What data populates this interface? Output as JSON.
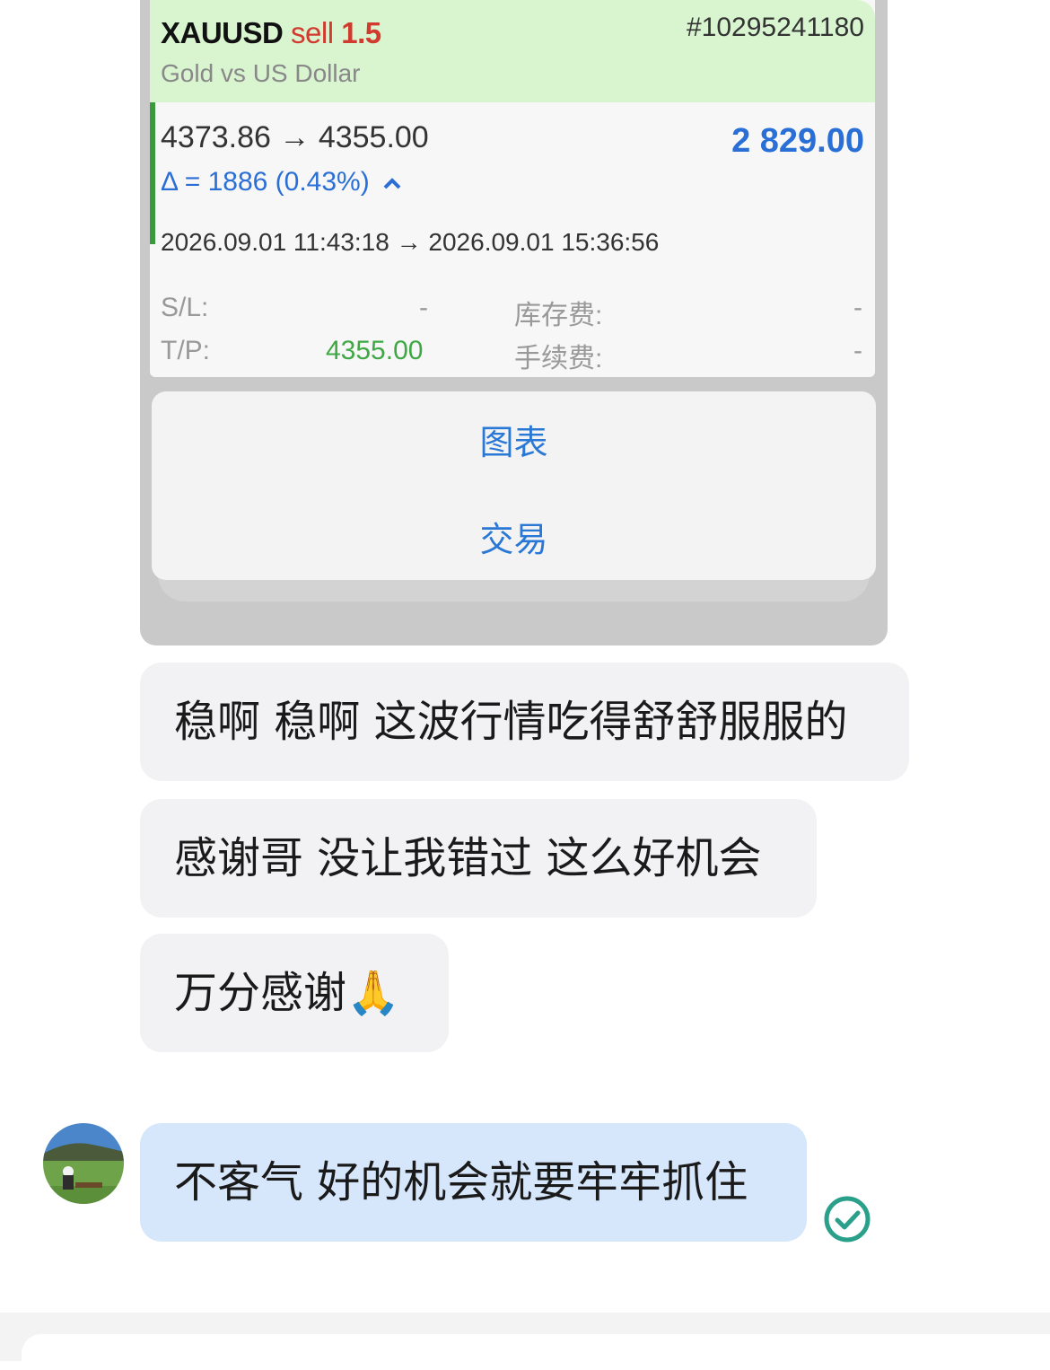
{
  "trade_card": {
    "symbol": "XAUUSD",
    "side": "sell",
    "lots": "1.5",
    "ticket": "#10295241180",
    "description": "Gold vs US Dollar",
    "price_open": "4373.86",
    "arrow": "→",
    "price_close": "4355.00",
    "profit": "2 829.00",
    "delta": "Δ = 1886 (0.43%)",
    "time_open": "2026.09.01 11:43:18",
    "time_close": "2026.09.01 15:36:56",
    "sl_label": "S/L:",
    "sl_value": "-",
    "tp_label": "T/P:",
    "tp_value": "4355.00",
    "swap_label": "库存费:",
    "swap_value": "-",
    "commission_label": "手续费:",
    "commission_value": "-"
  },
  "popup_menu": {
    "items": [
      "图表",
      "交易"
    ]
  },
  "messages": [
    {
      "text": "稳啊 稳啊 这波行情吃得舒舒服服的",
      "sender": "other"
    },
    {
      "text": "感谢哥 没让我错过 这么好机会",
      "sender": "other"
    },
    {
      "text": "万分感谢🙏",
      "sender": "other"
    },
    {
      "text": "不客气 好的机会就要牢牢抓住",
      "sender": "me",
      "status": "read"
    }
  ],
  "icons": {
    "read_receipt": "check-circle-icon",
    "avatar": "avatar"
  },
  "colors": {
    "sell": "#d13b2f",
    "profit": "#2a6fd6",
    "tp": "#3fa845",
    "menu_text": "#2a78d6",
    "my_bubble": "#d6e6fb",
    "other_bubble": "#f2f2f4",
    "check": "#2aa08a"
  }
}
